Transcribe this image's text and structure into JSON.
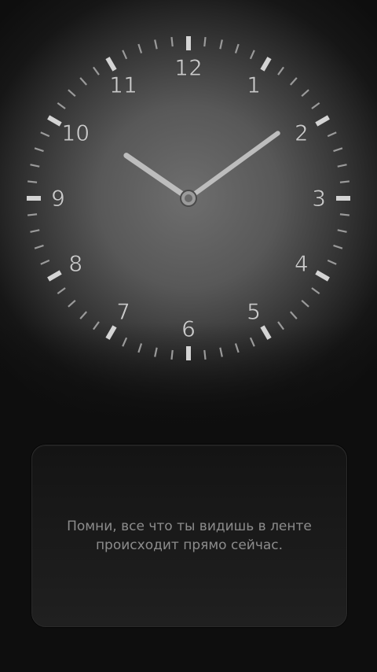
{
  "clock": {
    "numerals": [
      "12",
      "1",
      "2",
      "3",
      "4",
      "5",
      "6",
      "7",
      "8",
      "9",
      "10",
      "11"
    ],
    "time": {
      "hour": 10,
      "minute": 9
    },
    "colors": {
      "numeral": "#c9c9c9",
      "hand": "#bdbdbd",
      "tick": "#9a9a9a"
    }
  },
  "message": {
    "line1": "Помни, все что ты видишь в ленте",
    "line2": "происходит прямо сейчас."
  }
}
